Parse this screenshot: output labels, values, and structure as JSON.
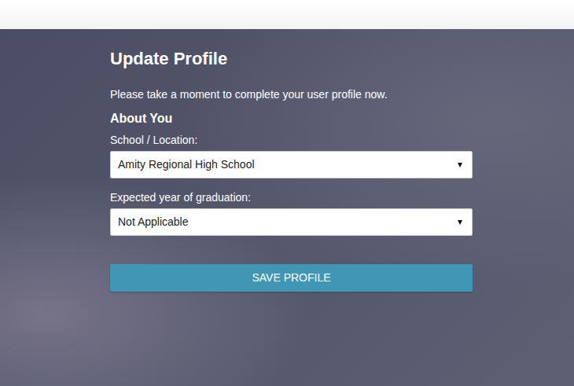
{
  "page": {
    "title": "Update Profile",
    "intro": "Please take a moment to complete your user profile now.",
    "section": "About You"
  },
  "fields": [
    {
      "label": "School / Location:",
      "value": "Amity Regional High School"
    },
    {
      "label": "Expected year of graduation:",
      "value": "Not Applicable"
    }
  ],
  "buttons": [
    "SAVE PROFILE"
  ]
}
